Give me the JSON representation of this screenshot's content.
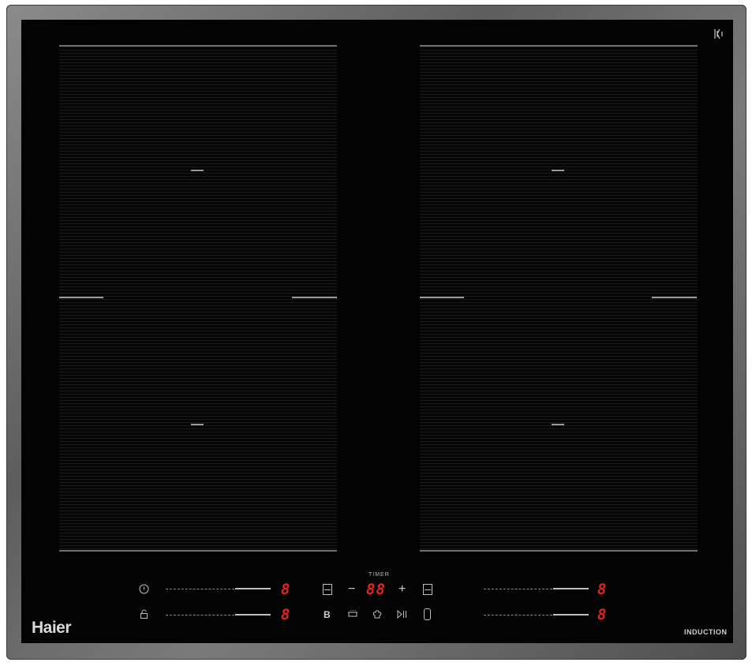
{
  "brand": "Haier",
  "badge": "INDUCTION",
  "timer": {
    "label": "TIMER",
    "display": "88",
    "minus": "−",
    "plus": "+"
  },
  "zones": {
    "left_top_display": "8",
    "left_bottom_display": "8",
    "right_top_display": "8",
    "right_bottom_display": "8"
  },
  "function_buttons": {
    "boost": "B"
  },
  "icons": {
    "top_right": "wifi-signal-icon",
    "power": "power-icon",
    "lock": "lock-icon",
    "boost": "boost-icon",
    "keep_warm": "keep-warm-icon",
    "chef": "chef-hat-icon",
    "pause": "play-pause-icon",
    "phone": "phone-icon",
    "bridge_left": "bridge-left-icon",
    "bridge_right": "bridge-right-icon"
  },
  "colors": {
    "display_red": "#e0251b",
    "glass": "#030303"
  }
}
